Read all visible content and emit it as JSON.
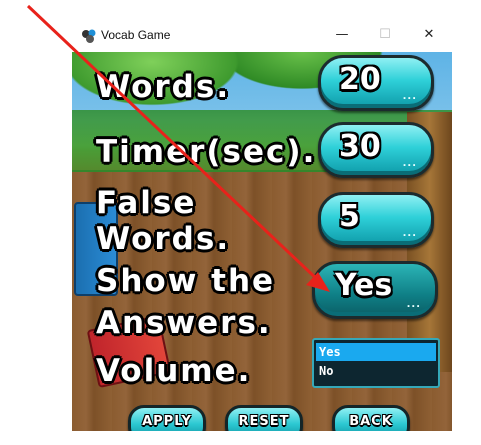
{
  "window": {
    "title": "Vocab Game",
    "controls": {
      "minimize": "—",
      "maximize": "☐",
      "close": "✕"
    }
  },
  "settings": {
    "rows": [
      {
        "label": "Words.",
        "value": "20"
      },
      {
        "label": "Timer(sec).",
        "value": "30"
      },
      {
        "label_line1": "False",
        "label_line2": "Words.",
        "value": "5"
      },
      {
        "label_line1": "Show the",
        "label_line2": "Answers.",
        "value": "Yes"
      },
      {
        "label": "Volume."
      }
    ],
    "dots": "..."
  },
  "dropdown": {
    "options": [
      "Yes",
      "No"
    ],
    "selected": "Yes"
  },
  "actions": {
    "apply": "APPLY",
    "reset": "RESET",
    "back": "BACK"
  },
  "colors": {
    "accent": "#2ed0d8",
    "selection": "#1aa9ef",
    "annotation_arrow": "#e8221b"
  }
}
